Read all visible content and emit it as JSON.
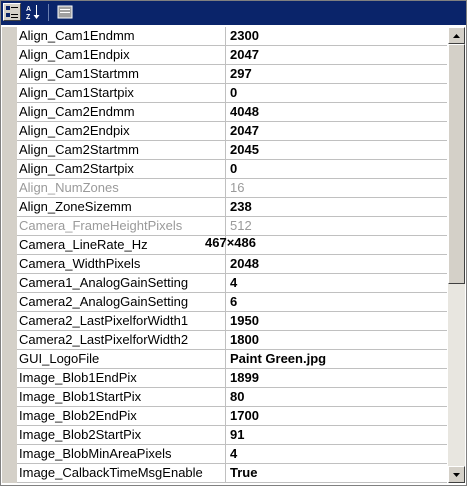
{
  "toolbar": {
    "buttons": [
      {
        "icon": "categorized-icon",
        "pressed": true
      },
      {
        "icon": "alphabetical-sort-icon",
        "pressed": false
      },
      {
        "icon": "property-pages-icon",
        "pressed": false
      }
    ]
  },
  "properties": [
    {
      "name": "Align_Cam1Endmm",
      "value": "2300",
      "disabled": false
    },
    {
      "name": "Align_Cam1Endpix",
      "value": "2047",
      "disabled": false
    },
    {
      "name": "Align_Cam1Startmm",
      "value": "297",
      "disabled": false
    },
    {
      "name": "Align_Cam1Startpix",
      "value": "0",
      "disabled": false
    },
    {
      "name": "Align_Cam2Endmm",
      "value": "4048",
      "disabled": false
    },
    {
      "name": "Align_Cam2Endpix",
      "value": "2047",
      "disabled": false
    },
    {
      "name": "Align_Cam2Startmm",
      "value": "2045",
      "disabled": false
    },
    {
      "name": "Align_Cam2Startpix",
      "value": "0",
      "disabled": false
    },
    {
      "name": "Align_NumZones",
      "value": "16",
      "disabled": true
    },
    {
      "name": "Align_ZoneSizemm",
      "value": "238",
      "disabled": false
    },
    {
      "name": "Camera_FrameHeightPixels",
      "value": "512",
      "disabled": true
    },
    {
      "name": "Camera_LineRate_Hz",
      "value": "",
      "disabled": false
    },
    {
      "name": "Camera_WidthPixels",
      "value": "2048",
      "disabled": false
    },
    {
      "name": "Camera1_AnalogGainSetting",
      "value": "4",
      "disabled": false
    },
    {
      "name": "Camera2_AnalogGainSetting",
      "value": "6",
      "disabled": false
    },
    {
      "name": "Camera2_LastPixelforWidth1",
      "value": "1950",
      "disabled": false
    },
    {
      "name": "Camera2_LastPixelforWidth2",
      "value": "1800",
      "disabled": false
    },
    {
      "name": "GUI_LogoFile",
      "value": "Paint Green.jpg",
      "disabled": false
    },
    {
      "name": "Image_Blob1EndPix",
      "value": "1899",
      "disabled": false
    },
    {
      "name": "Image_Blob1StartPix",
      "value": "80",
      "disabled": false
    },
    {
      "name": "Image_Blob2EndPix",
      "value": "1700",
      "disabled": false
    },
    {
      "name": "Image_Blob2StartPix",
      "value": "91",
      "disabled": false
    },
    {
      "name": "Image_BlobMinAreaPixels",
      "value": "4",
      "disabled": false
    },
    {
      "name": "Image_CalbackTimeMsgEnable",
      "value": "True",
      "disabled": false
    }
  ],
  "overlay_text": "467×486",
  "scrollbar": {
    "up_icon": "scroll-up-arrow-icon",
    "down_icon": "scroll-down-arrow-icon"
  }
}
